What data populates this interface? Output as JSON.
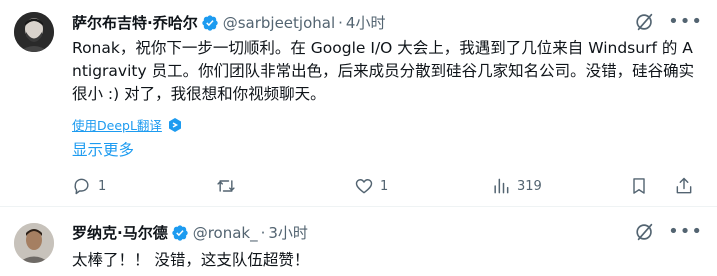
{
  "posts": [
    {
      "author_name": "萨尔布吉特·乔哈尔",
      "handle": "@sarbjeetjohal",
      "separator": "·",
      "time": "4小时",
      "text": "Ronak，祝你下一步一切顺利。在 Google I/O 大会上，我遇到了几位来自 Windsurf 的 Antigravity 员工。你们团队非常出色，后来成员分散到硅谷几家知名公司。没错，硅谷确实很小 :) 对了，我很想和你视频聊天。",
      "translate_label": "使用DeepL翻译",
      "show_more_label": "显示更多",
      "actions": {
        "reply_count": "1",
        "repost_count": "",
        "like_count": "1",
        "views_count": "319"
      }
    },
    {
      "author_name": "罗纳克·马尔德",
      "handle": "@ronak_",
      "separator": "·",
      "time": "3小时",
      "text": "太棒了！！ 没错，这支队伍超赞！"
    }
  ],
  "icons": {
    "verified": "verified-badge-icon",
    "grok": "grok-icon",
    "more": "more-icon",
    "reply": "reply-icon",
    "repost": "repost-icon",
    "like": "like-icon",
    "views": "views-icon",
    "bookmark": "bookmark-icon",
    "share": "share-icon",
    "deepl": "deepl-icon"
  },
  "colors": {
    "accent": "#1d9bf0",
    "text": "#0f1419",
    "muted": "#536471"
  }
}
